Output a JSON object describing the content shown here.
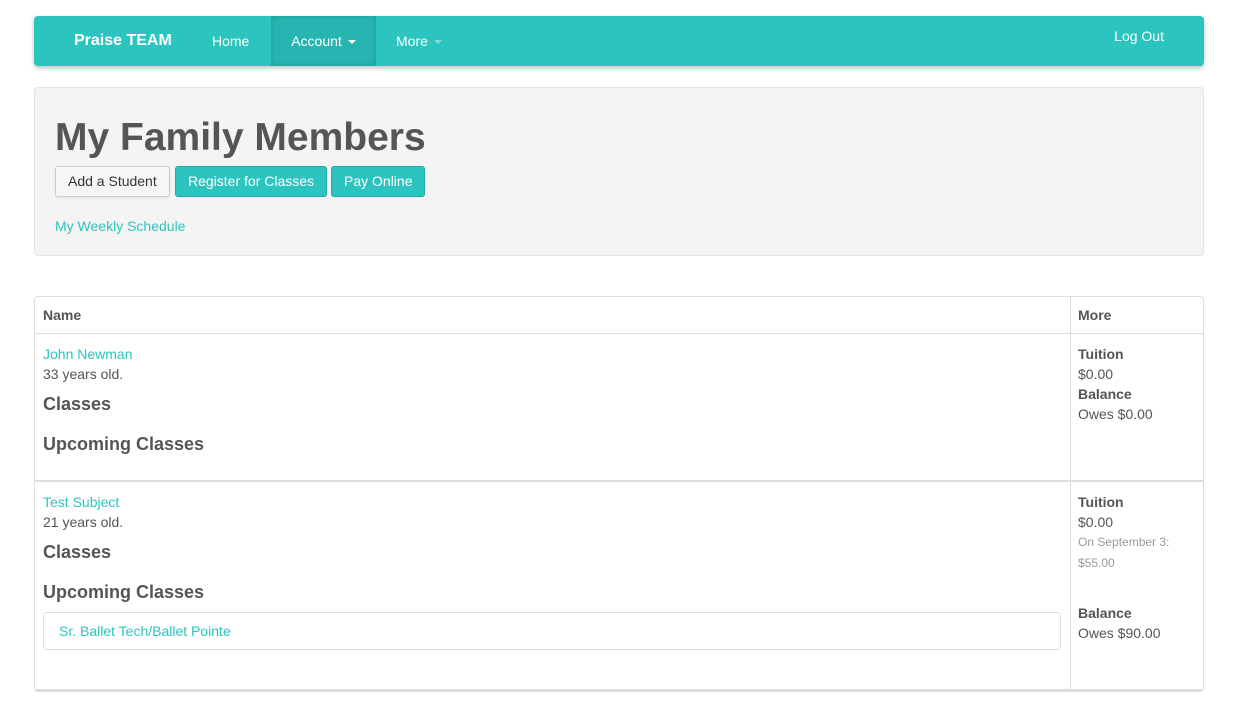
{
  "nav": {
    "brand": "Praise TEAM",
    "home": "Home",
    "account": "Account",
    "more": "More",
    "logout": "Log Out"
  },
  "header": {
    "title": "My Family Members",
    "add_student": "Add a Student",
    "register": "Register for Classes",
    "pay_online": "Pay Online",
    "weekly_schedule": "My Weekly Schedule"
  },
  "table": {
    "columns": [
      "Name",
      "More"
    ],
    "students": [
      {
        "name": "John Newman",
        "age": "33 years old.",
        "classes_heading": "Classes",
        "upcoming_heading": "Upcoming Classes",
        "tuition_label": "Tuition",
        "tuition_value": "$0.00",
        "balance_label": "Balance",
        "balance_value": "Owes $0.00"
      },
      {
        "name": "Test Subject",
        "age": "21 years old.",
        "classes_heading": "Classes",
        "upcoming_heading": "Upcoming Classes",
        "upcoming_classes": [
          "Sr. Ballet Tech/Ballet Pointe"
        ],
        "tuition_label": "Tuition",
        "tuition_value": "$0.00",
        "tuition_note_1": "On September 3:",
        "tuition_note_2": "$55.00",
        "balance_label": "Balance",
        "balance_value": "Owes $90.00"
      }
    ]
  },
  "colors": {
    "accent": "#2bc4bf",
    "text": "#555555",
    "muted": "#999999"
  }
}
